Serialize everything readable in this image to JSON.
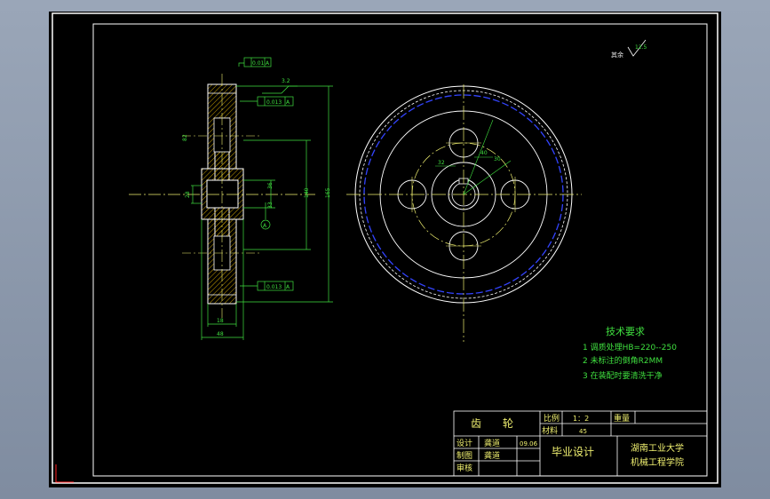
{
  "title_block": {
    "part_name": "齿　　轮",
    "scale_label": "比例",
    "scale_value": "1：2",
    "weight_label": "重量",
    "material_label": "材料",
    "material_value": "45",
    "design_label": "设计",
    "design_name": "龚道",
    "design_date": "09.06",
    "draw_label": "制图",
    "draw_name": "龚道",
    "review_label": "审核",
    "project": "毕业设计",
    "school_line1": "湖南工业大学",
    "school_line2": "机械工程学院"
  },
  "tech_req": {
    "title": "技术要求",
    "items": [
      "1  调质处理HB=220--250",
      "2  未标注的倒角R2MM",
      "3  在装配时要清洗干净"
    ]
  },
  "roughness_note": {
    "label": "其余",
    "value": "12.5"
  },
  "dims": {
    "tol_top": "0.01",
    "datum_a": "A",
    "rough_32": "3.2",
    "perp1": "0.013",
    "perp2": "0.013",
    "d_82": "82",
    "d_28": "28",
    "d_33": "33",
    "d_36": "36",
    "d_140": "140",
    "d_165": "165",
    "w_18": "18",
    "w_48": "48",
    "bore_32": "32",
    "r_40": "40",
    "r_30": "30"
  },
  "colors": {
    "frame": "#ffffff",
    "outline": "#ffffff",
    "center": "#f0f070",
    "dimension": "#3fe03f",
    "pitch": "#3344ff",
    "hatch": "#c8a000",
    "title_text": "#f0f070",
    "tech_text": "#3fe03f"
  }
}
